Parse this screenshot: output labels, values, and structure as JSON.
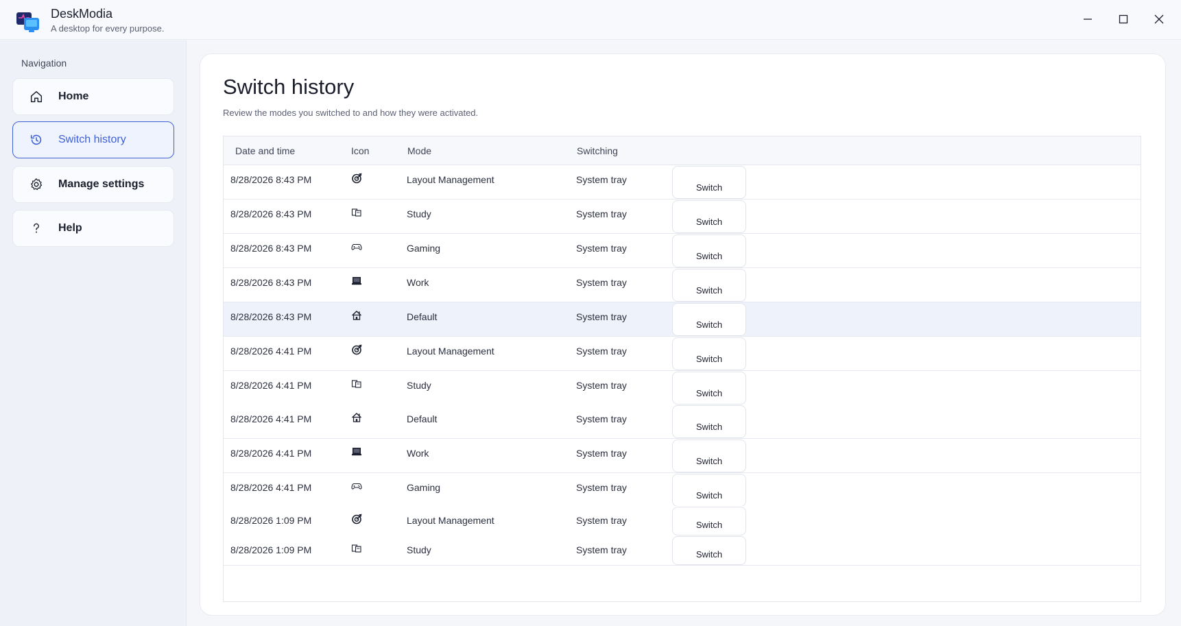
{
  "app": {
    "name": "DeskModia",
    "tagline": "A desktop for every purpose."
  },
  "window_controls": [
    "minimize-icon",
    "maximize-icon",
    "close-icon"
  ],
  "sidebar": {
    "heading": "Navigation",
    "items": [
      {
        "label": "Home",
        "icon": "home-icon"
      },
      {
        "label": "Switch history",
        "icon": "history-icon",
        "active": true
      },
      {
        "label": "Manage settings",
        "icon": "gear-icon"
      },
      {
        "label": "Help",
        "icon": "question-icon"
      }
    ]
  },
  "main": {
    "title": "Switch history",
    "subtitle": "Review the modes you switched to and how they were activated.",
    "table": {
      "headers": {
        "date": "Date and time",
        "icon": "Icon",
        "mode": "Mode",
        "switching": "Switching"
      },
      "button_label": "Switch",
      "rows": [
        {
          "date": "8/28/2026 8:43 PM",
          "icon": "target-icon",
          "mode": "Layout Management",
          "switching": "System tray"
        },
        {
          "date": "8/28/2026 8:43 PM",
          "icon": "books-icon",
          "mode": "Study",
          "switching": "System tray"
        },
        {
          "date": "8/28/2026 8:43 PM",
          "icon": "gamepad-icon",
          "mode": "Gaming",
          "switching": "System tray"
        },
        {
          "date": "8/28/2026 8:43 PM",
          "icon": "laptop-icon",
          "mode": "Work",
          "switching": "System tray"
        },
        {
          "date": "8/28/2026 8:43 PM",
          "icon": "house-icon",
          "mode": "Default",
          "switching": "System tray"
        },
        {
          "date": "8/28/2026 4:41 PM",
          "icon": "target-icon",
          "mode": "Layout Management",
          "switching": "System tray"
        },
        {
          "date": "8/28/2026 4:41 PM",
          "icon": "books-icon",
          "mode": "Study",
          "switching": "System tray"
        },
        {
          "date": "8/28/2026 4:41 PM",
          "icon": "house-icon",
          "mode": "Default",
          "switching": "System tray"
        },
        {
          "date": "8/28/2026 4:41 PM",
          "icon": "laptop-icon",
          "mode": "Work",
          "switching": "System tray"
        },
        {
          "date": "8/28/2026 4:41 PM",
          "icon": "gamepad-icon",
          "mode": "Gaming",
          "switching": "System tray"
        },
        {
          "date": "8/28/2026 1:09 PM",
          "icon": "target-icon",
          "mode": "Layout Management",
          "switching": "System tray"
        },
        {
          "date": "8/28/2026 1:09 PM",
          "icon": "books-icon",
          "mode": "Study",
          "switching": "System tray"
        }
      ]
    }
  },
  "colors": {
    "accent": "#3d5fd6",
    "highlight_row": "#eef2fa",
    "sidebar_bg": "#eef2f8"
  }
}
